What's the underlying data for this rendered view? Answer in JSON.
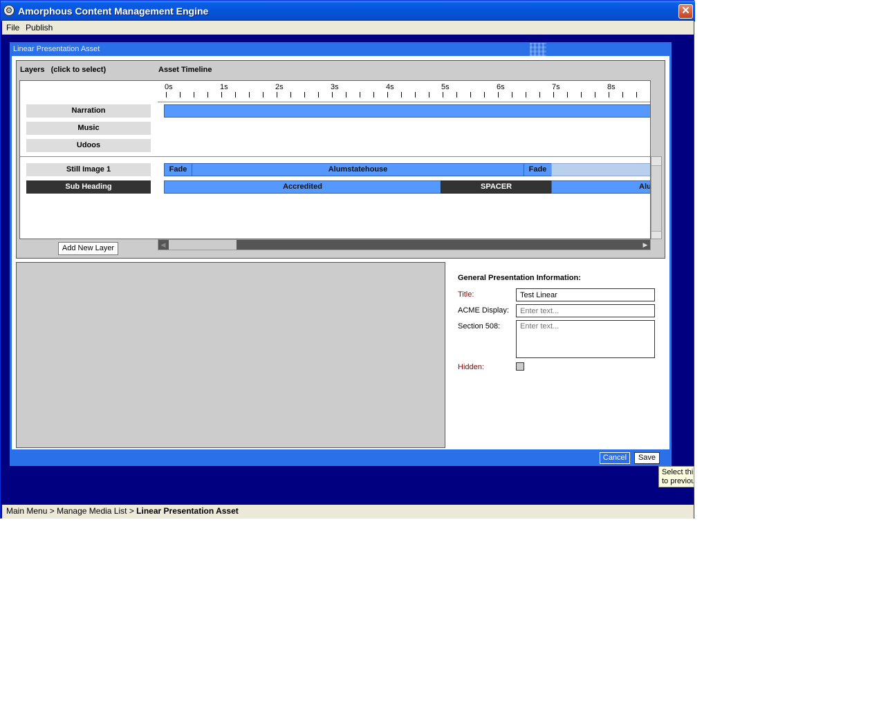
{
  "window": {
    "title": "Amorphous Content Management Engine"
  },
  "menu": {
    "file": "File",
    "publish": "Publish"
  },
  "dialog": {
    "title": "Linear Presentation Asset",
    "layers_header": "Layers   (click to select)",
    "timeline_header": "Asset Timeline",
    "layers": [
      "Narration",
      "Music",
      "Udoos",
      "Still Image 1",
      "Sub Heading"
    ],
    "selected_layer": "Sub Heading",
    "ticks": [
      "0s",
      "1s",
      "2s",
      "3s",
      "4s",
      "5s",
      "6s",
      "7s",
      "8s"
    ],
    "track_still": [
      "Fade",
      "Alumstatehouse",
      "Fade"
    ],
    "track_sub": [
      "Accredited",
      "SPACER",
      "Alu"
    ],
    "add_layer": "Add New Layer",
    "info_header": "General Presentation Information:",
    "title_label": "Title:",
    "title_value": "Test Linear",
    "acme_label": "ACME Display:",
    "acme_placeholder": "Enter text...",
    "s508_label": "Section 508:",
    "s508_placeholder": "Enter text...",
    "hidden_label": "Hidden:",
    "cancel": "Cancel",
    "save": "Save"
  },
  "tooltip": {
    "line1": "Select this",
    "line2": "to previou"
  },
  "breadcrumb": {
    "part1": "Main Menu",
    "sep": ">",
    "part2": "Manage Media List",
    "current": "Linear Presentation Asset"
  },
  "colors": {
    "segment": "#5599ff",
    "selected": "#333333",
    "dialog": "#2a70e8",
    "desktop": "#000080"
  }
}
